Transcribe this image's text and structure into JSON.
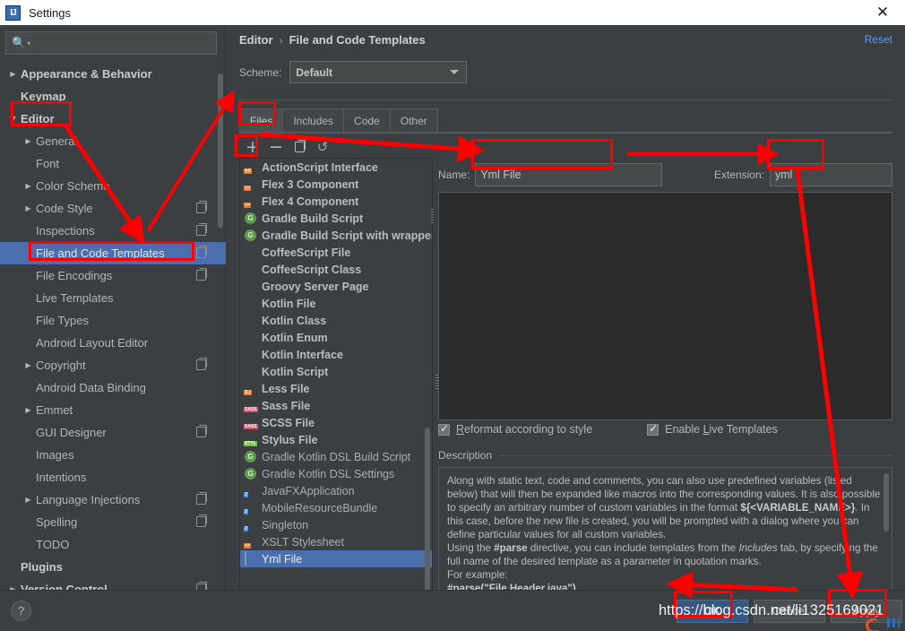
{
  "window": {
    "title": "Settings",
    "app_icon": "IJ",
    "close_icon": "✕"
  },
  "search": {
    "placeholder": "",
    "value": "",
    "icon": "search-icon"
  },
  "sidebar": {
    "items": [
      {
        "label": "Appearance & Behavior",
        "arrow": "collapsed",
        "bold": true,
        "indent": 1,
        "copy": false,
        "selected": false
      },
      {
        "label": "Keymap",
        "arrow": "none",
        "bold": true,
        "indent": 1,
        "copy": false,
        "selected": false
      },
      {
        "label": "Editor",
        "arrow": "expanded",
        "bold": true,
        "indent": 1,
        "copy": false,
        "selected": false
      },
      {
        "label": "General",
        "arrow": "collapsed",
        "bold": false,
        "indent": 2,
        "copy": false,
        "selected": false
      },
      {
        "label": "Font",
        "arrow": "none",
        "bold": false,
        "indent": 2,
        "copy": false,
        "selected": false
      },
      {
        "label": "Color Scheme",
        "arrow": "collapsed",
        "bold": false,
        "indent": 2,
        "copy": false,
        "selected": false
      },
      {
        "label": "Code Style",
        "arrow": "collapsed",
        "bold": false,
        "indent": 2,
        "copy": true,
        "selected": false
      },
      {
        "label": "Inspections",
        "arrow": "none",
        "bold": false,
        "indent": 2,
        "copy": true,
        "selected": false
      },
      {
        "label": "File and Code Templates",
        "arrow": "none",
        "bold": false,
        "indent": 2,
        "copy": true,
        "selected": true
      },
      {
        "label": "File Encodings",
        "arrow": "none",
        "bold": false,
        "indent": 2,
        "copy": true,
        "selected": false
      },
      {
        "label": "Live Templates",
        "arrow": "none",
        "bold": false,
        "indent": 2,
        "copy": false,
        "selected": false
      },
      {
        "label": "File Types",
        "arrow": "none",
        "bold": false,
        "indent": 2,
        "copy": false,
        "selected": false
      },
      {
        "label": "Android Layout Editor",
        "arrow": "none",
        "bold": false,
        "indent": 2,
        "copy": false,
        "selected": false
      },
      {
        "label": "Copyright",
        "arrow": "collapsed",
        "bold": false,
        "indent": 2,
        "copy": true,
        "selected": false
      },
      {
        "label": "Android Data Binding",
        "arrow": "none",
        "bold": false,
        "indent": 2,
        "copy": false,
        "selected": false
      },
      {
        "label": "Emmet",
        "arrow": "collapsed",
        "bold": false,
        "indent": 2,
        "copy": false,
        "selected": false
      },
      {
        "label": "GUI Designer",
        "arrow": "none",
        "bold": false,
        "indent": 2,
        "copy": true,
        "selected": false
      },
      {
        "label": "Images",
        "arrow": "none",
        "bold": false,
        "indent": 2,
        "copy": false,
        "selected": false
      },
      {
        "label": "Intentions",
        "arrow": "none",
        "bold": false,
        "indent": 2,
        "copy": false,
        "selected": false
      },
      {
        "label": "Language Injections",
        "arrow": "collapsed",
        "bold": false,
        "indent": 2,
        "copy": true,
        "selected": false
      },
      {
        "label": "Spelling",
        "arrow": "none",
        "bold": false,
        "indent": 2,
        "copy": true,
        "selected": false
      },
      {
        "label": "TODO",
        "arrow": "none",
        "bold": false,
        "indent": 2,
        "copy": false,
        "selected": false
      },
      {
        "label": "Plugins",
        "arrow": "none",
        "bold": true,
        "indent": 1,
        "copy": false,
        "selected": false
      },
      {
        "label": "Version Control",
        "arrow": "collapsed",
        "bold": true,
        "indent": 1,
        "copy": true,
        "selected": false
      }
    ]
  },
  "breadcrumb": {
    "parent": "Editor",
    "separator": "›",
    "current": "File and Code Templates",
    "reset_label": "Reset"
  },
  "scheme": {
    "label": "Scheme:",
    "value": "Default"
  },
  "tabs": [
    {
      "label": "Files",
      "active": true
    },
    {
      "label": "Includes",
      "active": false
    },
    {
      "label": "Code",
      "active": false
    },
    {
      "label": "Other",
      "active": false
    }
  ],
  "list_toolbar": {
    "add": "+",
    "remove": "−",
    "copy": "copy-icon",
    "reset": "↺"
  },
  "templates": [
    {
      "label": "ActionScript Interface",
      "icon": "file-as",
      "badge": "AS",
      "strong": true,
      "selected": false
    },
    {
      "label": "Flex 3 Component",
      "icon": "file-flex",
      "badge": "<>",
      "strong": true,
      "selected": false
    },
    {
      "label": "Flex 4 Component",
      "icon": "file-flex",
      "badge": "<>",
      "strong": true,
      "selected": false
    },
    {
      "label": "Gradle Build Script",
      "icon": "gradle",
      "badge": "G",
      "strong": true,
      "selected": false
    },
    {
      "label": "Gradle Build Script with wrapper",
      "icon": "gradle",
      "badge": "G",
      "strong": true,
      "selected": false
    },
    {
      "label": "CoffeeScript File",
      "icon": "coffee",
      "badge": "",
      "strong": true,
      "selected": false
    },
    {
      "label": "CoffeeScript Class",
      "icon": "coffee",
      "badge": "",
      "strong": true,
      "selected": false
    },
    {
      "label": "Groovy Server Page",
      "icon": "groovy",
      "badge": "G",
      "strong": true,
      "selected": false
    },
    {
      "label": "Kotlin File",
      "icon": "kotlin",
      "badge": "",
      "strong": true,
      "selected": false
    },
    {
      "label": "Kotlin Class",
      "icon": "kotlin",
      "badge": "",
      "strong": true,
      "selected": false
    },
    {
      "label": "Kotlin Enum",
      "icon": "kotlin",
      "badge": "",
      "strong": true,
      "selected": false
    },
    {
      "label": "Kotlin Interface",
      "icon": "kotlin",
      "badge": "",
      "strong": true,
      "selected": false
    },
    {
      "label": "Kotlin Script",
      "icon": "kotlin",
      "badge": "",
      "strong": true,
      "selected": false
    },
    {
      "label": "Less File",
      "icon": "file-less",
      "badge": "{L}",
      "strong": true,
      "selected": false
    },
    {
      "label": "Sass File",
      "icon": "file-sass",
      "badge": "SASS",
      "strong": true,
      "selected": false
    },
    {
      "label": "SCSS File",
      "icon": "file-sass",
      "badge": "SASS",
      "strong": true,
      "selected": false
    },
    {
      "label": "Stylus File",
      "icon": "file-stylus",
      "badge": "STYL",
      "strong": true,
      "selected": false
    },
    {
      "label": "Gradle Kotlin DSL Build Script",
      "icon": "gradle",
      "badge": "G",
      "strong": false,
      "selected": false
    },
    {
      "label": "Gradle Kotlin DSL Settings",
      "icon": "gradle",
      "badge": "G",
      "strong": false,
      "selected": false
    },
    {
      "label": "JavaFXApplication",
      "icon": "file-java",
      "badge": "J",
      "strong": false,
      "selected": false
    },
    {
      "label": "MobileResourceBundle",
      "icon": "file-java",
      "badge": "J",
      "strong": false,
      "selected": false
    },
    {
      "label": "Singleton",
      "icon": "file-java",
      "badge": "J",
      "strong": false,
      "selected": false
    },
    {
      "label": "XSLT Stylesheet",
      "icon": "file-xslt",
      "badge": "<>",
      "strong": false,
      "selected": false
    },
    {
      "label": "Yml File",
      "icon": "yml",
      "badge": "",
      "strong": false,
      "selected": true
    }
  ],
  "fields": {
    "name_label": "Name:",
    "name_value": "Yml File",
    "extension_label": "Extension:",
    "extension_value": "yml",
    "template_body": ""
  },
  "options": {
    "reformat": {
      "label": "Reformat according to style",
      "checked": true
    },
    "live_templates": {
      "label": "Enable Live Templates",
      "checked": true
    }
  },
  "description": {
    "title": "Description",
    "p1": "Along with static text, code and comments, you can also use predefined variables (listed below) that will then be expanded like macros into the corresponding values. It is also possible to specify an arbitrary number of custom variables in the format ",
    "var": "${<VARIABLE_NAME>}",
    "p2": ". In this case, before the new file is created, you will be prompted with a dialog where you can define particular values for all custom variables.",
    "p3_a": "Using the ",
    "p3_parse": "#parse",
    "p3_b": " directive, you can include templates from the ",
    "p3_inc": "Includes",
    "p3_c": " tab, by specifying the full name of the desired template as a parameter in quotation marks.",
    "p4": "For example:",
    "p5": "#parse(\"File Header.java\")"
  },
  "buttons": {
    "help": "?",
    "ok": "OK",
    "cancel": "Cancel",
    "apply": "Apply"
  },
  "watermark": {
    "text": "https://blog.csdn.net/li1325169021"
  },
  "annotation_color": "#ff0000"
}
